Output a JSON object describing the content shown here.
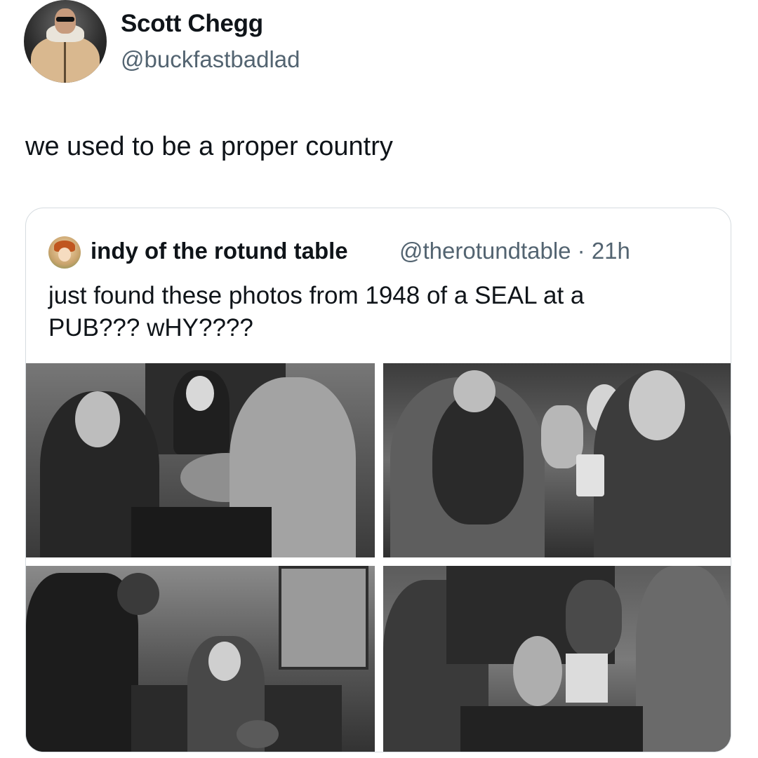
{
  "tweet": {
    "author": {
      "display_name": "Scott Chegg",
      "handle": "@buckfastbadlad",
      "avatar_icon": "profile-photo-man-sunglasses"
    },
    "text": "we used to be a proper country"
  },
  "quoted_tweet": {
    "author": {
      "display_name": "indy of the rotund table",
      "handle": "@therotundtable",
      "avatar_icon": "profile-photo-cartoon"
    },
    "meta": "@therotundtable · 21h",
    "text": "just found these photos from 1948 of a SEAL at a PUB??? wHY????",
    "photos": [
      {
        "alt": "black-and-white photo: man at bar counter holding seal, woman behind bar"
      },
      {
        "alt": "black-and-white photo: man holding seal, older man drinking"
      },
      {
        "alt": "black-and-white photo: elderly man seated in pub with seal"
      },
      {
        "alt": "black-and-white photo: seal at bar counter with barmaid"
      }
    ]
  },
  "colors": {
    "text_primary": "#0f1419",
    "text_secondary": "#536471",
    "border": "#d6dce0"
  }
}
